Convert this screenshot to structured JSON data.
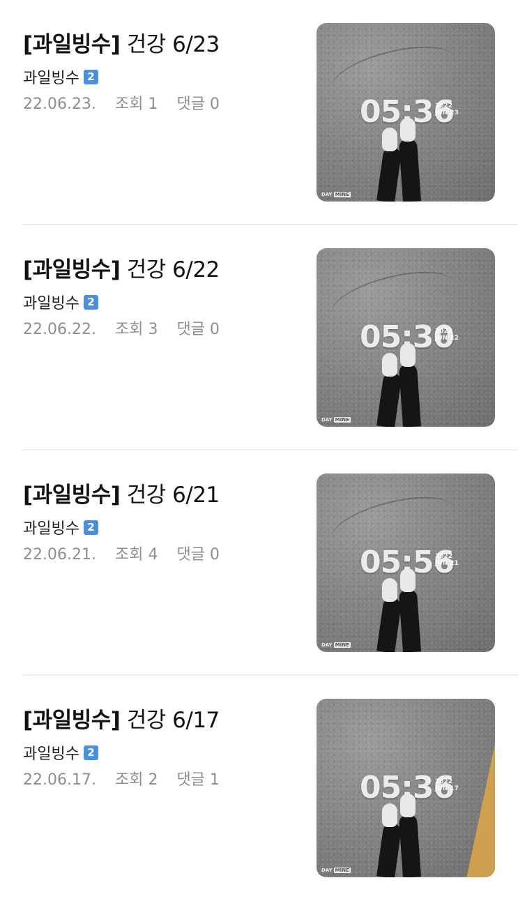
{
  "posts": [
    {
      "tag": "[과일빙수]",
      "title_rest": " 건강 6/23",
      "author": "과일빙수",
      "level": "2",
      "date": "22.06.23.",
      "views": "조회 1",
      "comments": "댓글 0",
      "thumb": {
        "time": "05:36",
        "year": "2022",
        "day": "JUN 23",
        "brand": "DAY",
        "brand_box": "MINE"
      }
    },
    {
      "tag": "[과일빙수]",
      "title_rest": " 건강 6/22",
      "author": "과일빙수",
      "level": "2",
      "date": "22.06.22.",
      "views": "조회 3",
      "comments": "댓글 0",
      "thumb": {
        "time": "05:30",
        "year": "2022",
        "day": "JUN 22",
        "brand": "DAY",
        "brand_box": "MINE"
      }
    },
    {
      "tag": "[과일빙수]",
      "title_rest": " 건강 6/21",
      "author": "과일빙수",
      "level": "2",
      "date": "22.06.21.",
      "views": "조회 4",
      "comments": "댓글 0",
      "thumb": {
        "time": "05:56",
        "year": "2022",
        "day": "JUN 21",
        "brand": "DAY",
        "brand_box": "MINE"
      }
    },
    {
      "tag": "[과일빙수]",
      "title_rest": " 건강 6/17",
      "author": "과일빙수",
      "level": "2",
      "date": "22.06.17.",
      "views": "조회 2",
      "comments": "댓글 1",
      "thumb": {
        "time": "05:36",
        "year": "2022",
        "day": "JUN 17",
        "brand": "DAY",
        "brand_box": "MINE"
      }
    }
  ],
  "colors": {
    "level_badge": "#4a90e2",
    "meta_text": "#8e8e8e",
    "divider": "#ececec"
  }
}
